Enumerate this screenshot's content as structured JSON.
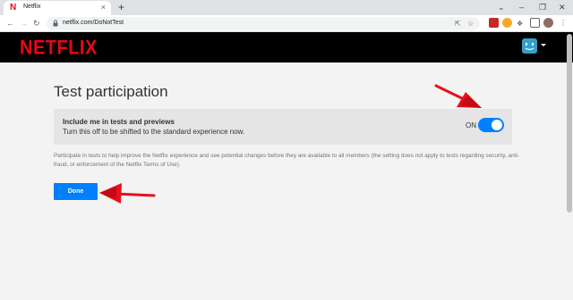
{
  "browser": {
    "tab_title": "Netflix",
    "tab_close": "×",
    "new_tab": "+",
    "url": "netflix.com/DoNotTest",
    "window_controls": [
      "⌄",
      "–",
      "❐",
      "✕"
    ]
  },
  "header": {
    "logo_text": "NETFLIX"
  },
  "page": {
    "title": "Test participation",
    "setting": {
      "label": "Include me in tests and previews",
      "description": "Turn this off to be shifted to the standard experience now.",
      "state": "ON",
      "enabled": true
    },
    "help_text": "Participate in tests to help improve the Netflix experience and see potential changes before they are available to all members (the setting does not apply to tests regarding security, anti-fraud, or enforcement of the Netflix Terms of Use).",
    "done_label": "Done"
  },
  "colors": {
    "netflix_red": "#e50914",
    "toggle_blue": "#0080ff",
    "annotation_red": "#e8101a"
  }
}
